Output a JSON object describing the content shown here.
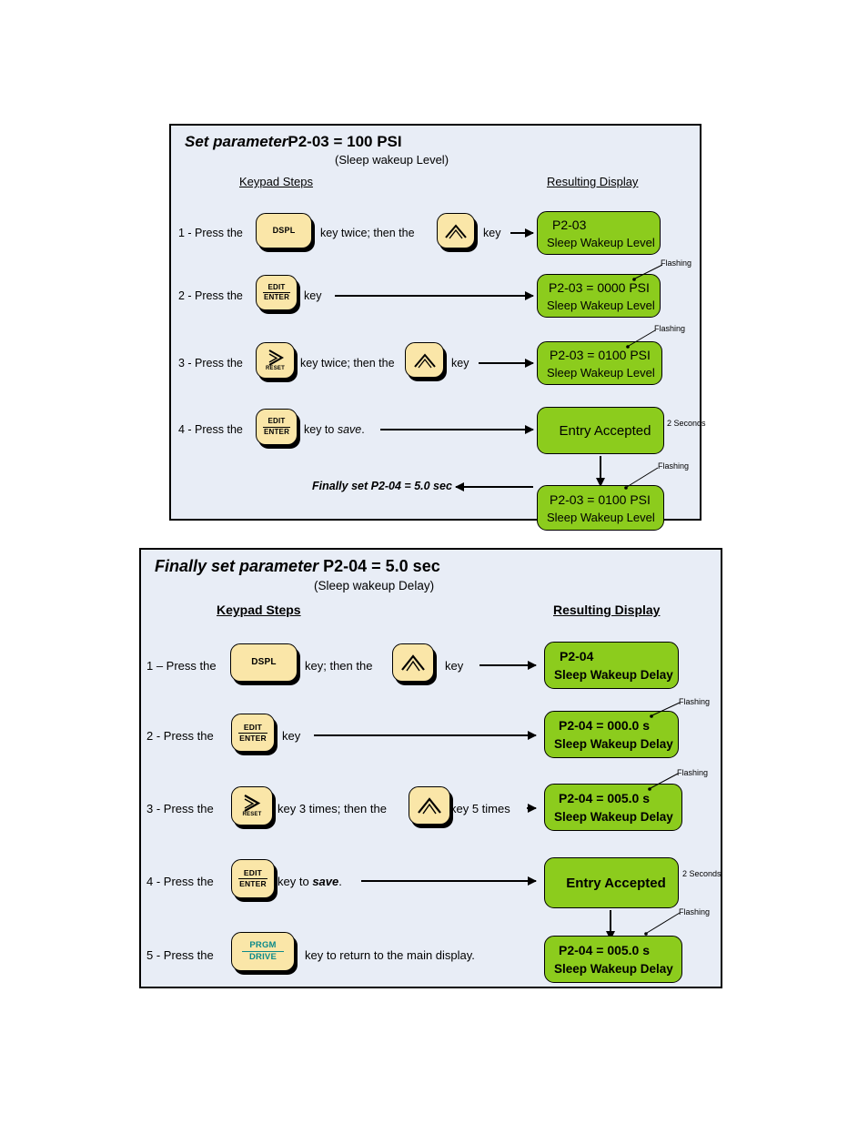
{
  "document": {
    "type": "instruction-diagram",
    "background_color": "#ffffff"
  },
  "colors": {
    "panel_background": "#e8edf6",
    "panel_border": "#000000",
    "key_face": "#fae6a8",
    "key_shadow": "#000000",
    "display_green": "#8ccc1d",
    "teal_text": "#0c8a8a"
  },
  "panel1": {
    "title_part1": "Set  parameter",
    "title_part2": "P2-03 = 100 PSI",
    "subtitle": "(Sleep wakeup Level)",
    "col_left": "Keypad Steps",
    "col_right": "Resulting Display",
    "steps": [
      {
        "num": "1 - Press the",
        "key1": {
          "label": "DSPL",
          "type": "text"
        },
        "mid": "key twice; then the",
        "key2": {
          "label": "up-chevron",
          "type": "icon"
        },
        "tail": "key",
        "display": {
          "line1": "P2-03",
          "line2": "Sleep Wakeup Level"
        }
      },
      {
        "num": "2 - Press the",
        "key1": {
          "label_top": "EDIT",
          "label_bottom": "ENTER",
          "type": "split"
        },
        "mid": "key",
        "display": {
          "line1": "P2-03 = 0000 PSI",
          "line2": "Sleep Wakeup Level"
        },
        "annotation": "Flashing"
      },
      {
        "num": "3 - Press the",
        "key1": {
          "label": "RESET",
          "type": "icon-right-chevron"
        },
        "mid": "key twice; then the",
        "key2": {
          "label": "up-chevron",
          "type": "icon"
        },
        "tail": "key",
        "display": {
          "line1": "P2-03 = 0100 PSI",
          "line2": "Sleep Wakeup Level"
        },
        "annotation": "Flashing"
      },
      {
        "num": "4 - Press the",
        "key1": {
          "label_top": "EDIT",
          "label_bottom": "ENTER",
          "type": "split"
        },
        "mid": "key to",
        "mid_emph": "save",
        "mid_end": ".",
        "display": {
          "line1": "Entry Accepted"
        },
        "annotation": "2 Seconds"
      }
    ],
    "final_note": "Finally set P2-04 = 5.0 sec",
    "final_display": {
      "line1": "P2-03 = 0100 PSI",
      "line2": "Sleep Wakeup Level"
    },
    "final_annotation": "Flashing"
  },
  "panel2": {
    "title_part1": "Finally set  parameter",
    "title_part2": "P2-04 = 5.0 sec",
    "subtitle": "(Sleep wakeup Delay)",
    "col_left": "Keypad Steps",
    "col_right": "Resulting Display",
    "steps": [
      {
        "num": "1 – Press the",
        "key1": {
          "label": "DSPL",
          "type": "text"
        },
        "mid": "key; then the",
        "key2": {
          "label": "up-chevron",
          "type": "icon"
        },
        "tail": "key",
        "display": {
          "line1": "P2-04",
          "line2": "Sleep Wakeup Delay"
        }
      },
      {
        "num": "2 - Press the",
        "key1": {
          "label_top": "EDIT",
          "label_bottom": "ENTER",
          "type": "split"
        },
        "mid": "key",
        "display": {
          "line1": "P2-04 = 000.0 s",
          "line2": "Sleep Wakeup Delay"
        },
        "annotation": "Flashing"
      },
      {
        "num": "3 - Press the",
        "key1": {
          "label": "RESET",
          "type": "icon-right-chevron"
        },
        "mid": "key 3 times; then the",
        "key2": {
          "label": "up-chevron",
          "type": "icon"
        },
        "tail": "key 5 times",
        "display": {
          "line1": "P2-04 = 005.0 s",
          "line2": "Sleep Wakeup Delay"
        },
        "annotation": "Flashing"
      },
      {
        "num": "4 - Press the",
        "key1": {
          "label_top": "EDIT",
          "label_bottom": "ENTER",
          "type": "split"
        },
        "mid": "key to",
        "mid_emph": "save",
        "mid_end": ".",
        "display": {
          "line1": "Entry Accepted"
        },
        "annotation": "2 Seconds"
      },
      {
        "num": "5 - Press the",
        "key1": {
          "label_top": "PRGM",
          "label_bottom": "DRIVE",
          "type": "split-teal"
        },
        "mid": "key to return to the main display.",
        "display": {
          "line1": "P2-04 = 005.0 s",
          "line2": "Sleep Wakeup Delay"
        },
        "annotation": "Flashing"
      }
    ]
  }
}
